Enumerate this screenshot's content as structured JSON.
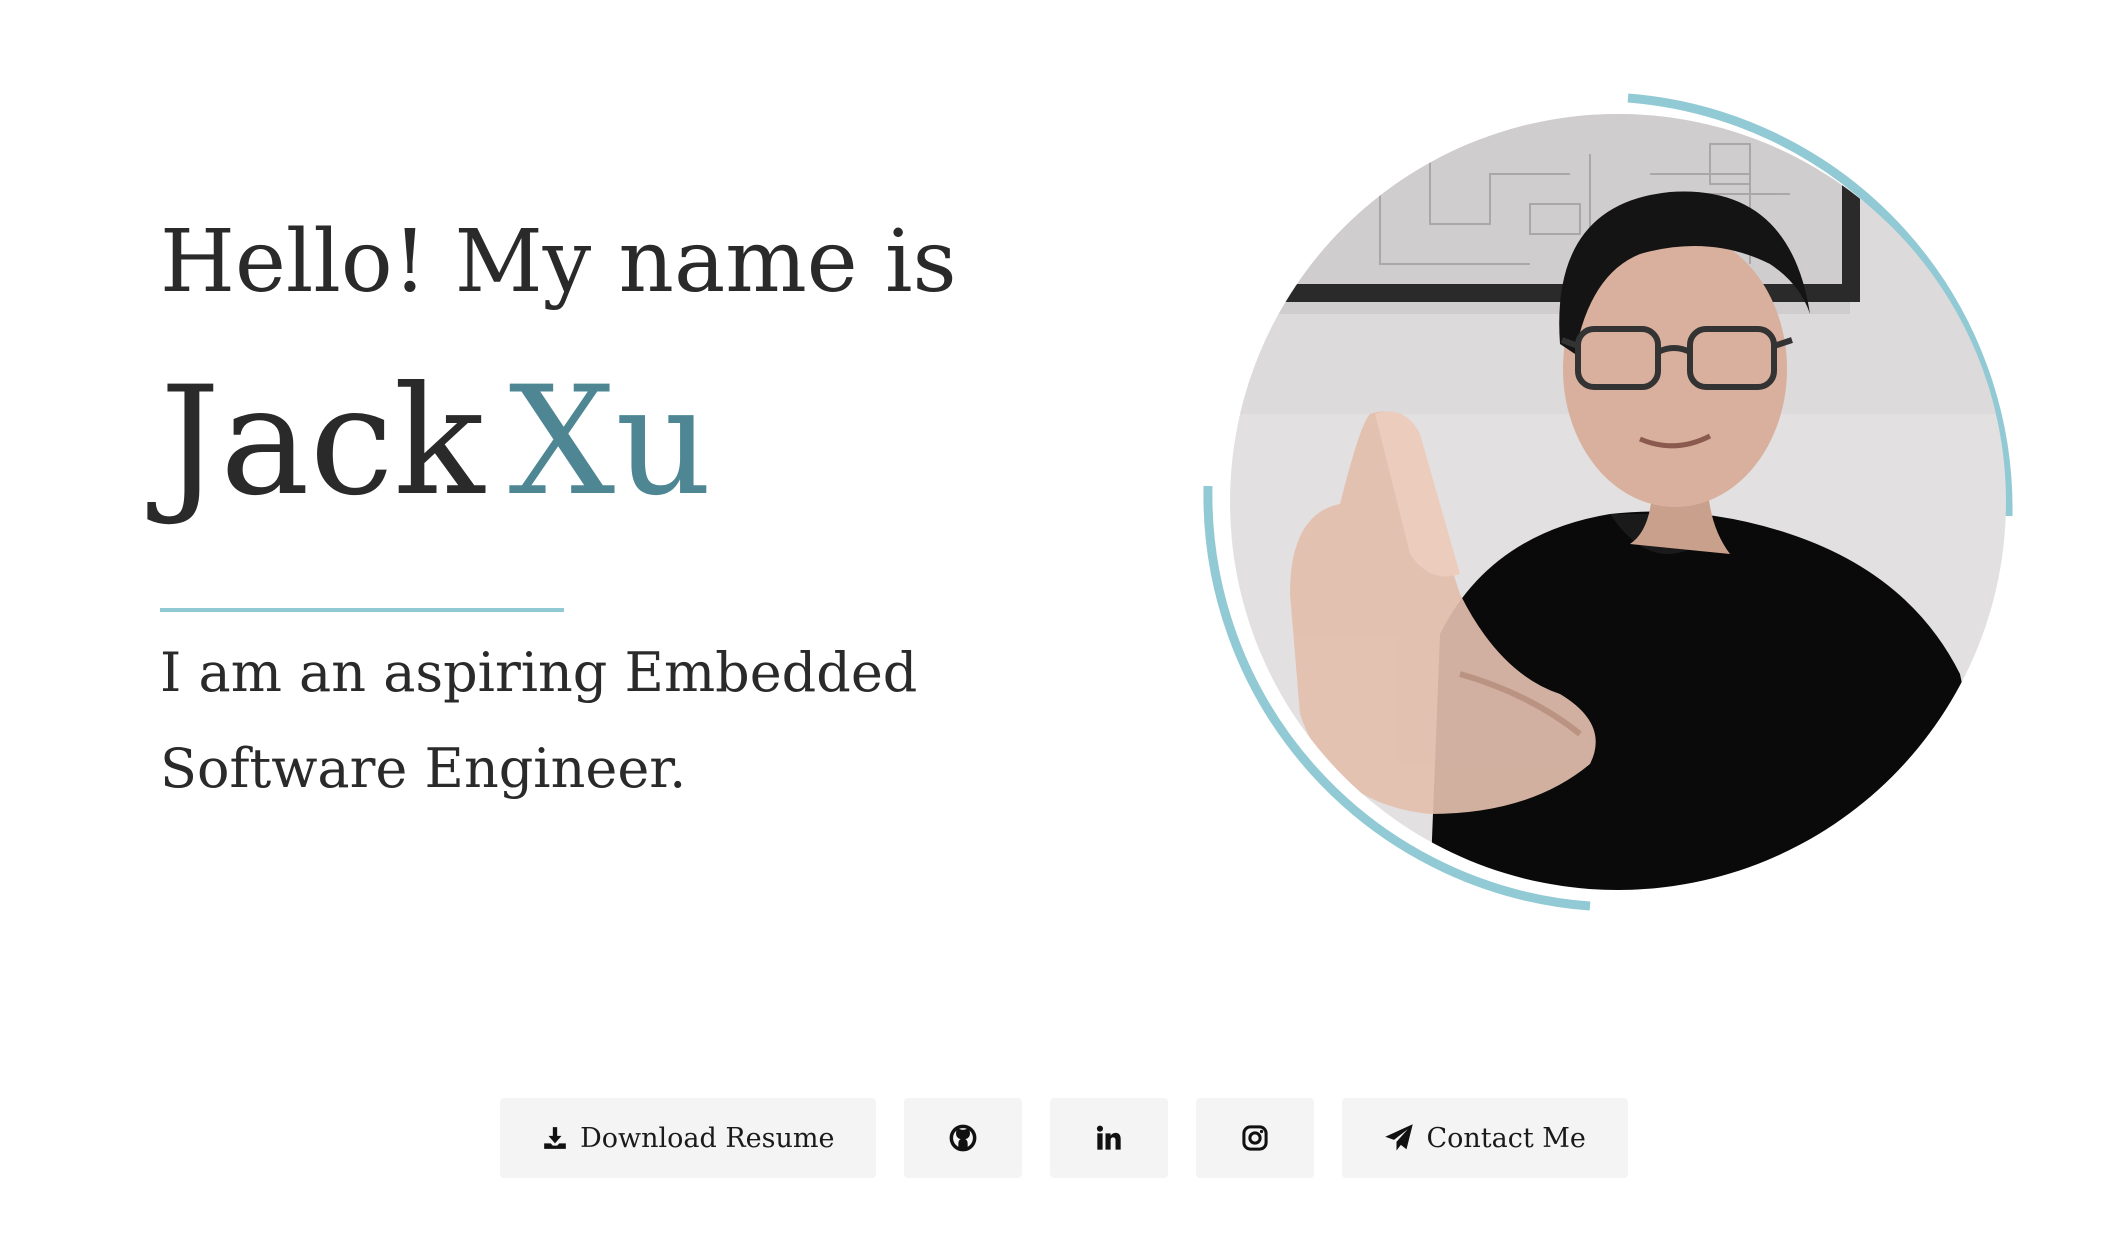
{
  "hero": {
    "greeting": "Hello! My name is",
    "first_name": "Jack",
    "last_name": "Xu",
    "tagline": "I am an aspiring Embedded Software Engineer."
  },
  "buttons": {
    "download_resume": {
      "label": "Download Resume",
      "icon": "download-icon"
    },
    "github": {
      "icon": "github-icon"
    },
    "linkedin": {
      "icon": "linkedin-icon"
    },
    "instagram": {
      "icon": "instagram-icon"
    },
    "contact": {
      "label": "Contact Me",
      "icon": "paper-plane-icon"
    }
  },
  "colors": {
    "accent": "#4e8793",
    "ring": "#91cad4",
    "text": "#2a2a2a",
    "button_bg": "#f4f4f4"
  }
}
